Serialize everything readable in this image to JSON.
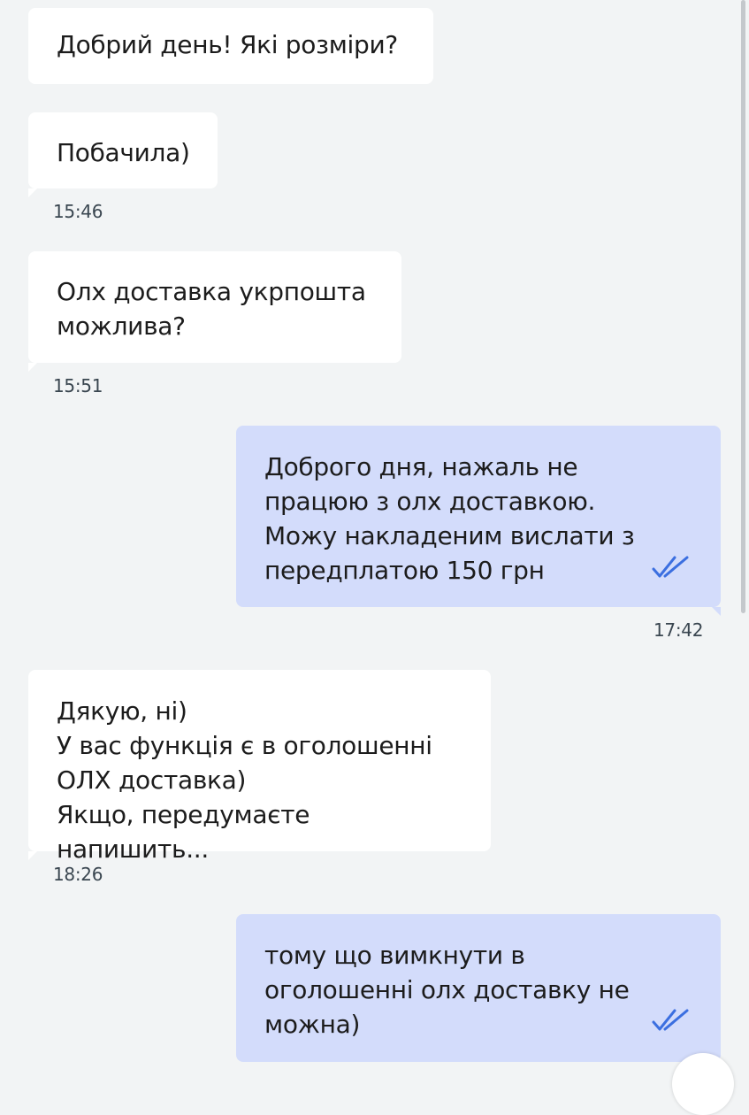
{
  "messages": [
    {
      "direction": "incoming",
      "text": "Добрий день! Які розміри?",
      "time": ""
    },
    {
      "direction": "incoming",
      "text": "Побачила)",
      "time": "15:46"
    },
    {
      "direction": "incoming",
      "text": "Олх доставка укрпошта\nможлива?",
      "time": "15:51"
    },
    {
      "direction": "outgoing",
      "text": "Доброго дня, нажаль не\nпрацюю з олх доставкою.\nМожу накладеним вислати з\nпередплатою 150 грн",
      "time": "17:42",
      "status_icon": "double-check-icon"
    },
    {
      "direction": "incoming",
      "text": "Дякую, ні)\nУ вас функція є в оголошенні\nОЛХ доставка)\nЯкщо, передумаєте напишить...",
      "time": "18:26"
    },
    {
      "direction": "outgoing",
      "text": "тому що вимкнути в\nоголошенні олх доставку не\nможна)",
      "time": "",
      "status_icon": "double-check-icon"
    }
  ],
  "colors": {
    "background": "#f2f4f5",
    "incoming_bubble": "#ffffff",
    "outgoing_bubble": "#d3dcfb",
    "read_check": "#3b6fe0"
  }
}
